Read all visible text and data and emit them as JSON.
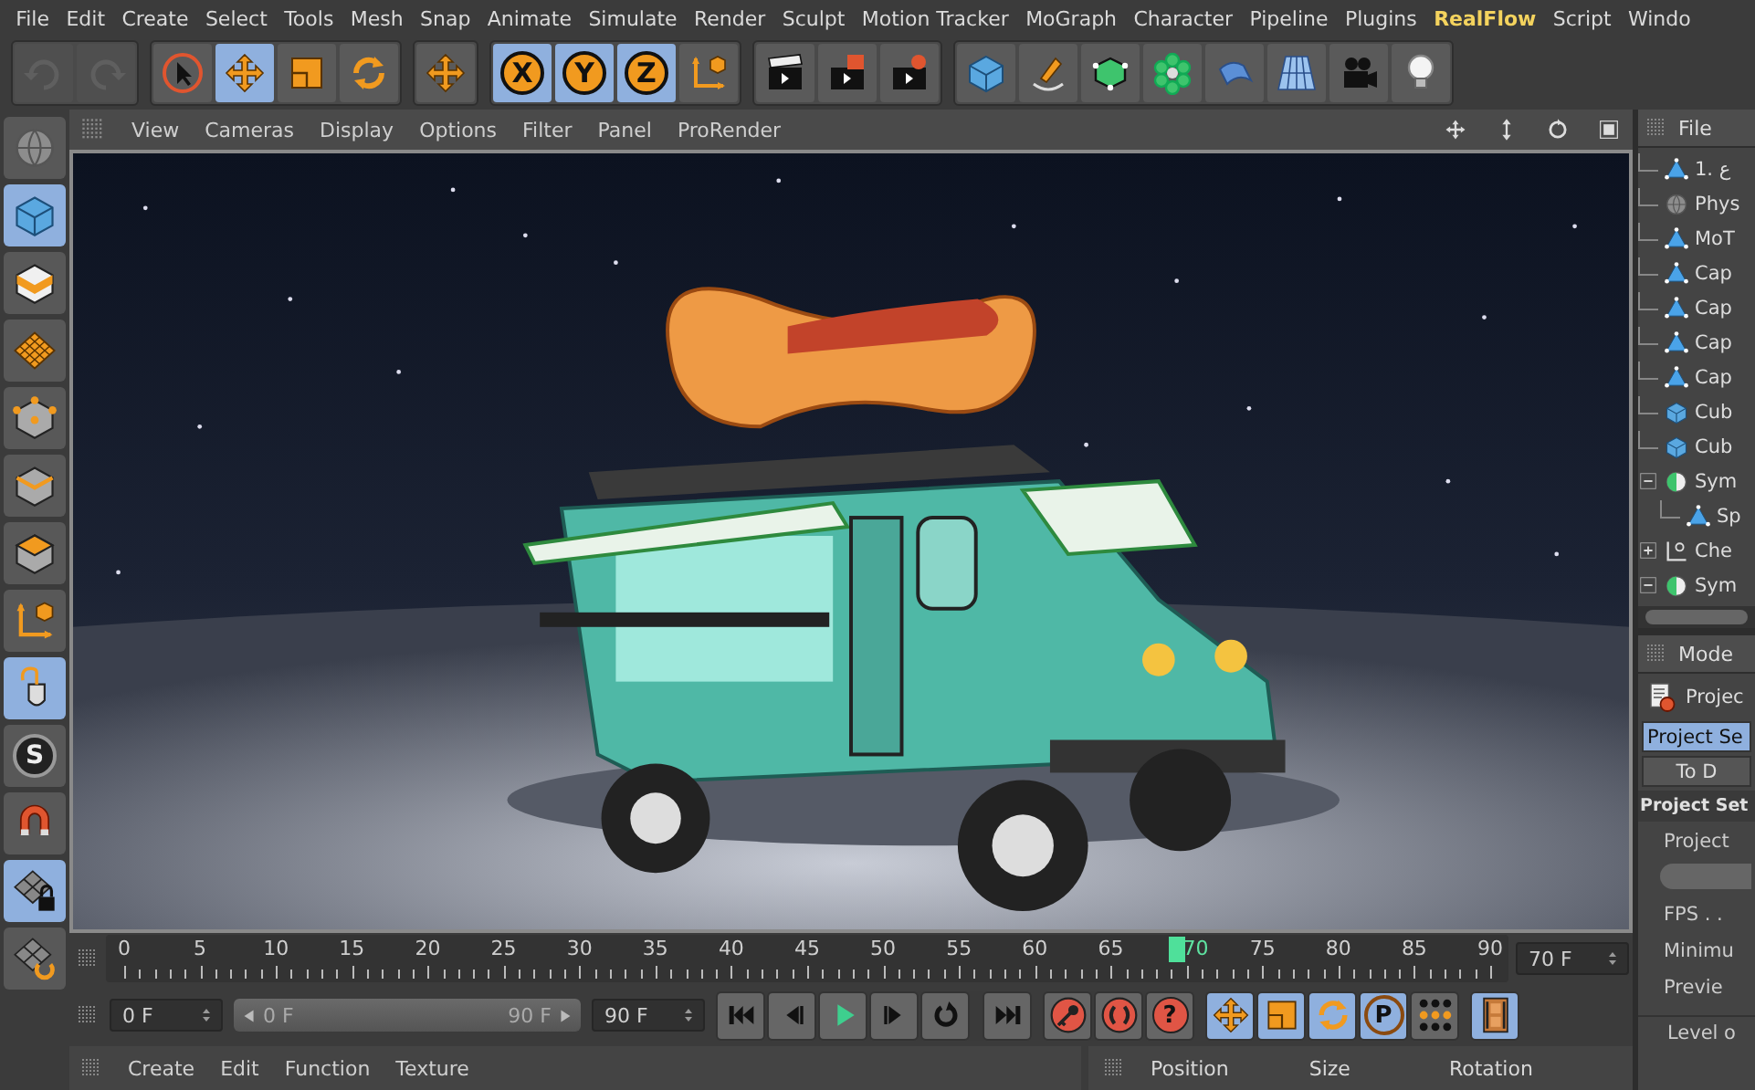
{
  "menu_bar": [
    {
      "label": "File",
      "highlighted": false
    },
    {
      "label": "Edit",
      "highlighted": false
    },
    {
      "label": "Create",
      "highlighted": false
    },
    {
      "label": "Select",
      "highlighted": false
    },
    {
      "label": "Tools",
      "highlighted": false
    },
    {
      "label": "Mesh",
      "highlighted": false
    },
    {
      "label": "Snap",
      "highlighted": false
    },
    {
      "label": "Animate",
      "highlighted": false
    },
    {
      "label": "Simulate",
      "highlighted": false
    },
    {
      "label": "Render",
      "highlighted": false
    },
    {
      "label": "Sculpt",
      "highlighted": false
    },
    {
      "label": "Motion Tracker",
      "highlighted": false
    },
    {
      "label": "MoGraph",
      "highlighted": false
    },
    {
      "label": "Character",
      "highlighted": false
    },
    {
      "label": "Pipeline",
      "highlighted": false
    },
    {
      "label": "Plugins",
      "highlighted": false
    },
    {
      "label": "RealFlow",
      "highlighted": true
    },
    {
      "label": "Script",
      "highlighted": false
    },
    {
      "label": "Windo",
      "highlighted": false
    }
  ],
  "top_toolbar": [
    {
      "buttons": [
        {
          "selected": false,
          "disabled": true
        },
        {
          "selected": false,
          "disabled": true
        }
      ]
    },
    {
      "buttons": [
        {
          "selected": false,
          "disabled": false
        },
        {
          "selected": true,
          "disabled": false
        },
        {
          "selected": false,
          "disabled": false
        },
        {
          "selected": false,
          "disabled": false
        }
      ]
    },
    {
      "buttons": [
        {
          "selected": false,
          "disabled": false
        }
      ]
    },
    {
      "buttons": [
        {
          "label": "X",
          "selected": true,
          "disabled": false
        },
        {
          "label": "Y",
          "selected": true,
          "disabled": false
        },
        {
          "label": "Z",
          "selected": true,
          "disabled": false
        },
        {
          "selected": false,
          "disabled": false
        }
      ]
    },
    {
      "buttons": [
        {
          "selected": false,
          "disabled": false
        },
        {
          "selected": false,
          "disabled": false
        },
        {
          "selected": false,
          "disabled": false
        }
      ]
    },
    {
      "buttons": [
        {
          "selected": false,
          "disabled": false
        },
        {
          "selected": false,
          "disabled": false
        },
        {
          "selected": false,
          "disabled": false
        },
        {
          "selected": false,
          "disabled": false
        },
        {
          "selected": false,
          "disabled": false
        },
        {
          "selected": false,
          "disabled": false
        },
        {
          "selected": false,
          "disabled": false
        },
        {
          "selected": false,
          "disabled": false
        }
      ]
    }
  ],
  "left_toolbar": [
    {
      "selected": false
    },
    {
      "selected": true
    },
    {
      "selected": false
    },
    {
      "selected": false
    },
    {
      "selected": false
    },
    {
      "selected": false
    },
    {
      "selected": false
    },
    {
      "selected": false
    },
    {
      "selected": true
    },
    {
      "label": "S",
      "selected": false
    },
    {
      "selected": false
    },
    {
      "selected": true
    },
    {
      "selected": false
    }
  ],
  "viewport": {
    "menu": [
      "View",
      "Cameras",
      "Display",
      "Options",
      "Filter",
      "Panel",
      "ProRender"
    ]
  },
  "timeline": {
    "labels": [
      {
        "text": "0",
        "selected": false
      },
      {
        "text": "5",
        "selected": false
      },
      {
        "text": "10",
        "selected": false
      },
      {
        "text": "15",
        "selected": false
      },
      {
        "text": "20",
        "selected": false
      },
      {
        "text": "25",
        "selected": false
      },
      {
        "text": "30",
        "selected": false
      },
      {
        "text": "35",
        "selected": false
      },
      {
        "text": "40",
        "selected": false
      },
      {
        "text": "45",
        "selected": false
      },
      {
        "text": "50",
        "selected": false
      },
      {
        "text": "55",
        "selected": false
      },
      {
        "text": "60",
        "selected": false
      },
      {
        "text": "65",
        "selected": false
      },
      {
        "text": "70",
        "selected": true
      },
      {
        "text": "75",
        "selected": false
      },
      {
        "text": "80",
        "selected": false
      },
      {
        "text": "85",
        "selected": false
      },
      {
        "text": "90",
        "selected": false
      }
    ],
    "level": 0.778,
    "current_frame": "70 F"
  },
  "playback": {
    "start_frame": "0 F",
    "range": {
      "start": "0 F",
      "end": "90 F",
      "level": 1
    },
    "end_frame": "90 F",
    "transport_buttons": [
      {
        "selected": false
      },
      {
        "selected": false
      },
      {
        "selected": false
      },
      {
        "selected": false
      },
      {
        "selected": false
      },
      {
        "selected": false
      }
    ],
    "key_buttons": [
      {
        "selected": false
      },
      {
        "selected": false
      },
      {
        "label": "?",
        "selected": false
      }
    ],
    "mode_buttons": [
      {
        "selected": true
      },
      {
        "selected": true
      },
      {
        "selected": true
      },
      {
        "label": "P",
        "selected": true
      },
      {
        "selected": false
      }
    ],
    "layout_button": {
      "selected": true
    }
  },
  "material_manager": {
    "menu": [
      "Create",
      "Edit",
      "Function",
      "Texture"
    ]
  },
  "coordinates": {
    "columns": [
      "Position",
      "Size",
      "Rotation"
    ]
  },
  "object_manager": {
    "menu": [
      "File"
    ],
    "tree": [
      {
        "label": "1. ع",
        "kind": "polygon"
      },
      {
        "label": "Phys",
        "kind": "scene"
      },
      {
        "label": "MoT",
        "kind": "polygon"
      },
      {
        "label": "Cap",
        "kind": "polygon"
      },
      {
        "label": "Cap",
        "kind": "polygon"
      },
      {
        "label": "Cap",
        "kind": "polygon"
      },
      {
        "label": "Cap",
        "kind": "polygon"
      },
      {
        "label": "Cub",
        "kind": "cube"
      },
      {
        "label": "Cub",
        "kind": "cube"
      },
      {
        "label": "Sym",
        "kind": "symmetry",
        "expanded": true,
        "children": [
          {
            "label": "Sp",
            "kind": "polygon"
          }
        ]
      },
      {
        "label": "Che",
        "kind": "null",
        "expanded": false
      },
      {
        "label": "Sym",
        "kind": "symmetry",
        "expanded": true
      }
    ]
  },
  "attribute_manager": {
    "menu": [
      "Mode"
    ],
    "object": "Projec",
    "tabs": [
      {
        "label": "Project Se",
        "selected": true
      },
      {
        "label": "To D",
        "selected": false
      }
    ],
    "section": "Project Set",
    "fields": [
      {
        "label": "Project",
        "kind": "slider"
      },
      {
        "label": "FPS . .",
        "kind": "row"
      },
      {
        "label": "Minimu",
        "kind": "row"
      },
      {
        "label": "Previe",
        "kind": "row"
      },
      {
        "label": "Level o",
        "kind": "row"
      }
    ]
  }
}
